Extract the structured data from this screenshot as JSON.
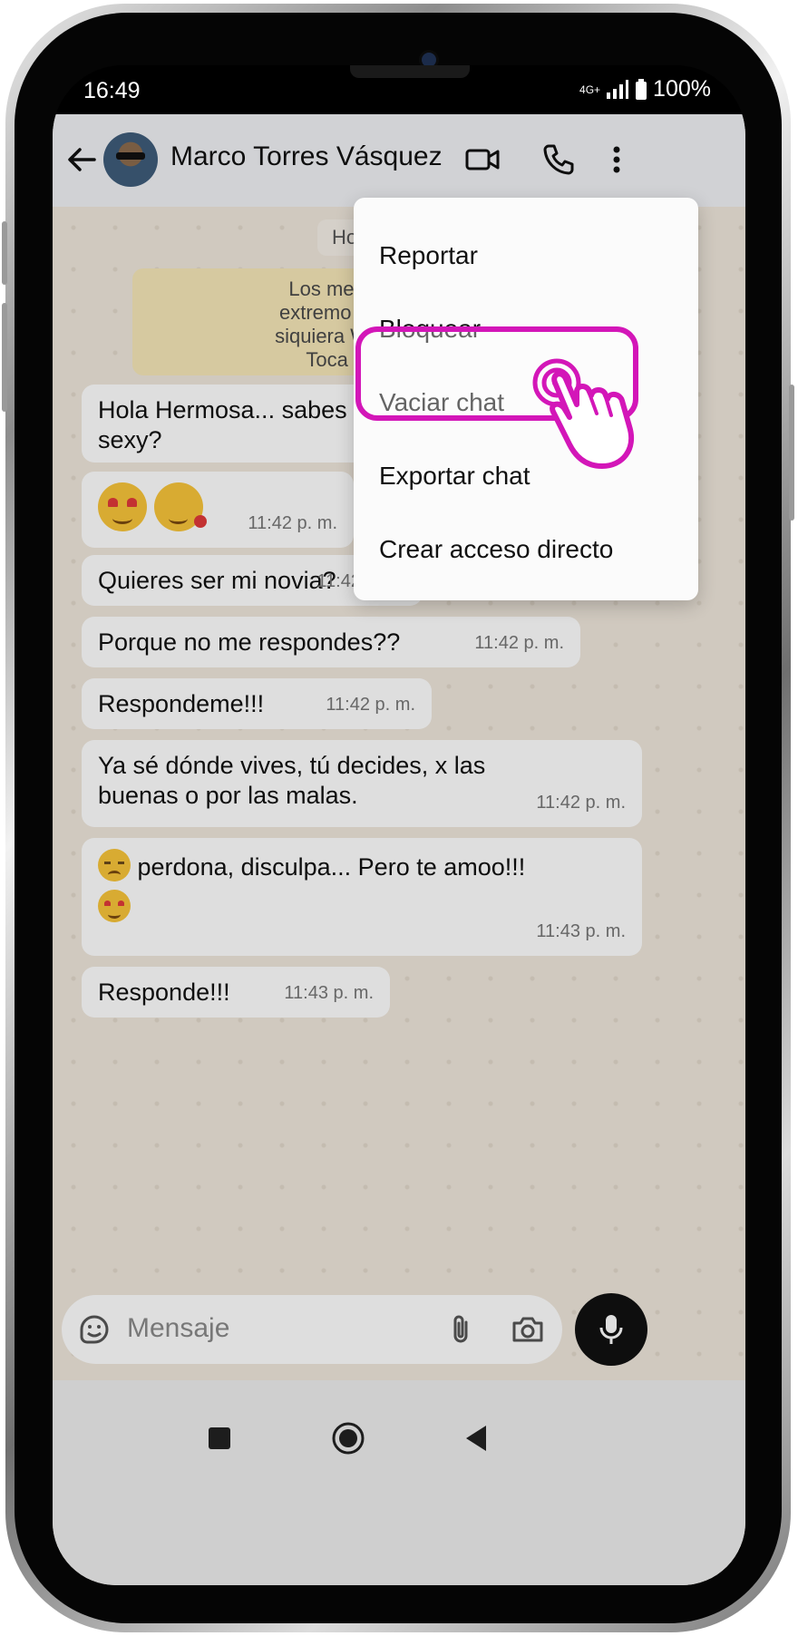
{
  "status_bar": {
    "time": "16:49",
    "network": "4G+",
    "battery": "100%"
  },
  "header": {
    "contact_name": "Marco Torres Vásquez"
  },
  "chat": {
    "date_label": "Ho",
    "encryption_notice": [
      "Los mensajes y las lla",
      "extremo a extremo. Nad",
      "siquiera WhatsApp, pued",
      "Toca para obtener"
    ],
    "messages": [
      {
        "text_line1": "Hola Hermosa... sabes q",
        "text_line2": "sexy?"
      },
      {
        "time": "11:42 p. m."
      },
      {
        "text": "Quieres ser mi novia?",
        "time": "11:42 p. m."
      },
      {
        "text": "Porque no me respondes??",
        "time": "11:42 p. m."
      },
      {
        "text": "Respondeme!!!",
        "time": "11:42 p. m."
      },
      {
        "text_line1": "Ya sé dónde vives, tú decides, x las",
        "text_line2": "buenas o por las malas.",
        "time": "11:42 p. m."
      },
      {
        "text": "perdona, disculpa... Pero te amoo!!!",
        "time": "11:43 p. m."
      },
      {
        "text": "Responde!!!",
        "time": "11:43 p. m."
      }
    ]
  },
  "menu": {
    "items": [
      "Reportar",
      "Bloquear",
      "Vaciar chat",
      "Exportar chat",
      "Crear acceso directo"
    ],
    "highlighted": "Bloquear"
  },
  "input": {
    "placeholder": "Mensaje"
  },
  "colors": {
    "highlight": "#d316b8",
    "chat_bg": "#efe7dc",
    "notice_bg": "#f6e7b8"
  }
}
